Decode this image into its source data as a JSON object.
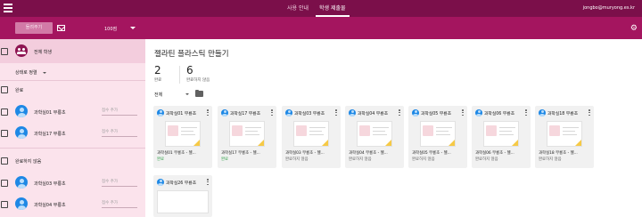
{
  "topbar": {
    "tabs": [
      {
        "label": "사용 안내",
        "active": false
      },
      {
        "label": "학생 제출물",
        "active": true
      }
    ],
    "account": "jongbo@muryong.es.kr"
  },
  "toolbar": {
    "reply_label": "돌려주기",
    "points": "100점"
  },
  "sidebar": {
    "all_students": "전체 학생",
    "sort_label": "상태로 정렬",
    "sections": [
      {
        "label": "완료",
        "students": [
          {
            "name": "과학실01 무룡초",
            "grade_placeholder": "점수 추가"
          },
          {
            "name": "과학실17 무룡초",
            "grade_placeholder": "점수 추가"
          }
        ]
      },
      {
        "label": "완료하지 않음",
        "students": [
          {
            "name": "과학실03 무룡초",
            "grade_placeholder": "점수 추가"
          },
          {
            "name": "과학실04 무룡초",
            "grade_placeholder": "점수 추가"
          }
        ]
      }
    ]
  },
  "main": {
    "title": "젤라틴 플라스틱 만들기",
    "stats": [
      {
        "value": "2",
        "label": "완료"
      },
      {
        "value": "6",
        "label": "완료하지 않음"
      }
    ],
    "filter_label": "전체",
    "cards": [
      {
        "name": "과학실01 무룡초",
        "file": "과학실01 무룡초 - 젤...",
        "status": "완료",
        "status_type": "done",
        "thumb": "doc"
      },
      {
        "name": "과학실17 무룡초",
        "file": "과학실17 무룡초 - 젤...",
        "status": "완료",
        "status_type": "done",
        "thumb": "doc"
      },
      {
        "name": "과학실03 무룡초",
        "file": "과학실03 무룡초 - 젤...",
        "status": "완료하지 않음",
        "status_type": "missing",
        "thumb": "doc"
      },
      {
        "name": "과학실04 무룡초",
        "file": "과학실04 무룡초 - 젤...",
        "status": "완료하지 않음",
        "status_type": "missing",
        "thumb": "doc"
      },
      {
        "name": "과학실05 무룡초",
        "file": "과학실05 무룡초 - 젤...",
        "status": "완료하지 않음",
        "status_type": "missing",
        "thumb": "doc"
      },
      {
        "name": "과학실06 무룡초",
        "file": "과학실06 무룡초 - 젤...",
        "status": "완료하지 않음",
        "status_type": "missing",
        "thumb": "doc"
      },
      {
        "name": "과학실18 무룡초",
        "file": "과학실18 무룡초 - 젤...",
        "status": "완료하지 않음",
        "status_type": "missing",
        "thumb": "doc"
      },
      {
        "name": "과학실26 무룡초",
        "file": "",
        "status": "",
        "status_type": "missing",
        "thumb": "blank"
      }
    ]
  },
  "colors": {
    "topbar": "#7b0f4a",
    "toolbar": "#a4155f",
    "sidebar": "#fbe3ec",
    "done": "#2e9e45"
  }
}
